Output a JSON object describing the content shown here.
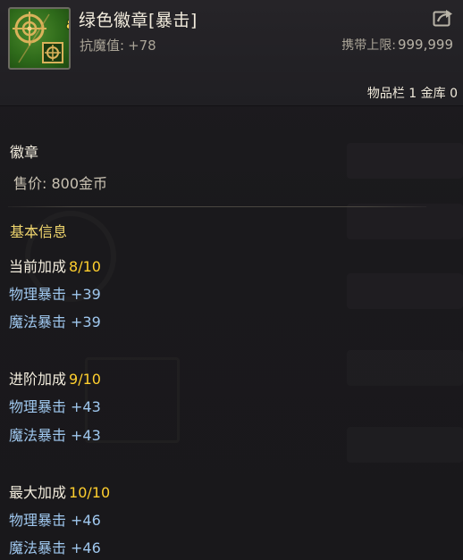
{
  "item": {
    "name": "绿色徽章[暴击]",
    "level_badge": "8",
    "stat_label": "抗魔值:",
    "stat_value": "+78",
    "carry_label": "携带上限:",
    "carry_value": "999,999",
    "storage": "物品栏 1 金库 0"
  },
  "category": "徽章",
  "price": "售价: 800金币",
  "section_title": "基本信息",
  "tiers": [
    {
      "label": "当前加成",
      "level": "8/10",
      "stats": [
        {
          "name": "物理暴击",
          "value": "+39"
        },
        {
          "name": "魔法暴击",
          "value": "+39"
        }
      ]
    },
    {
      "label": "进阶加成",
      "level": "9/10",
      "stats": [
        {
          "name": "物理暴击",
          "value": "+43"
        },
        {
          "name": "魔法暴击",
          "value": "+43"
        }
      ]
    },
    {
      "label": "最大加成",
      "level": "10/10",
      "stats": [
        {
          "name": "物理暴击",
          "value": "+46"
        },
        {
          "name": "魔法暴击",
          "value": "+46"
        }
      ]
    }
  ],
  "icons": {
    "item": "green-emblem-crosshair-icon",
    "share": "share-arrow-icon"
  },
  "colors": {
    "tier_level": "#ffcf2e",
    "section_title": "#f0d66e",
    "stat_blue": "#9fc7ee"
  }
}
